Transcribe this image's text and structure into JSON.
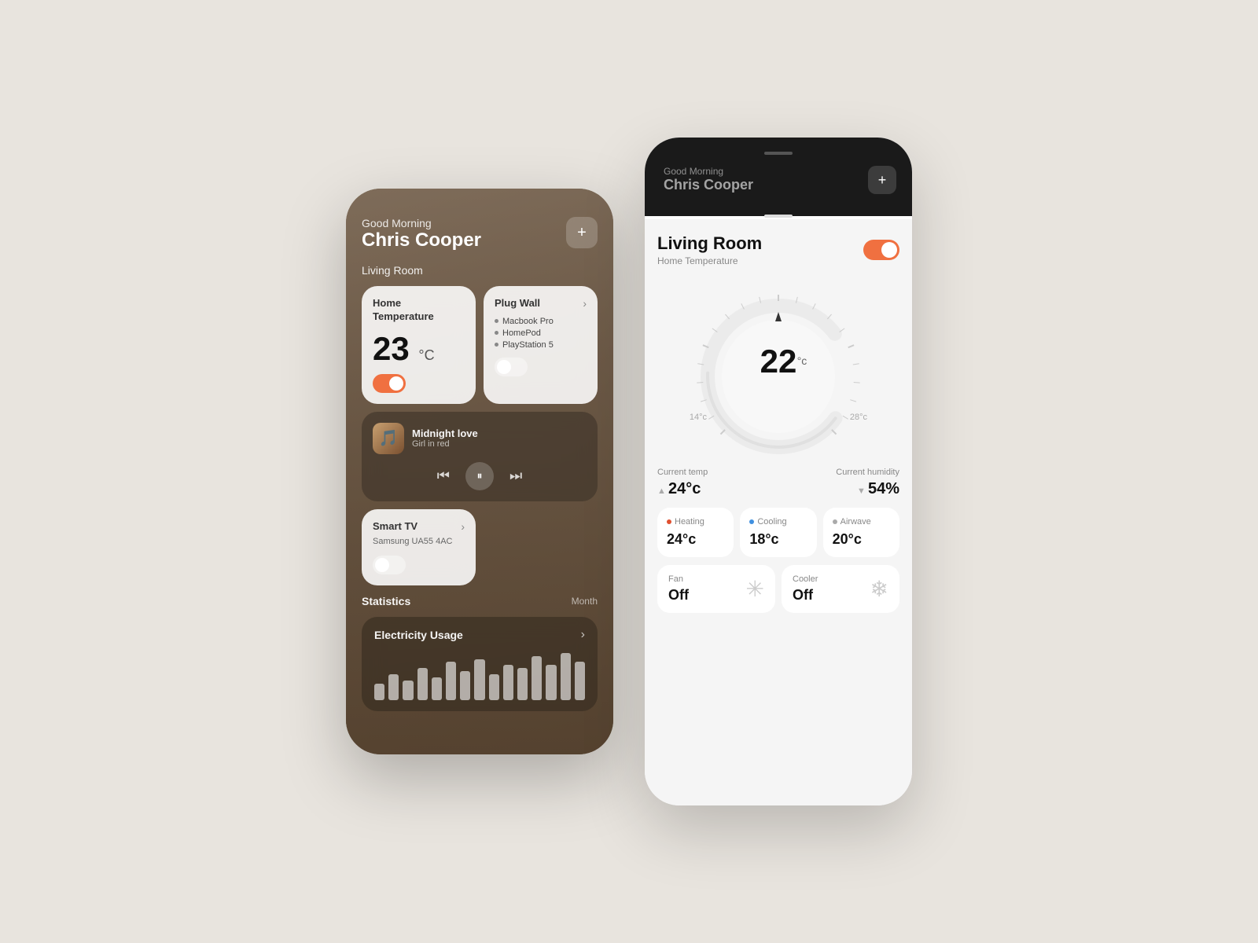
{
  "left_phone": {
    "greeting_small": "Good Morning",
    "greeting_name": "Chris Cooper",
    "add_btn": "+",
    "section": "Living Room",
    "temp_card": {
      "title_line1": "Home",
      "title_line2": "Temperature",
      "value": "23",
      "unit": "°C",
      "toggle_on": true
    },
    "plug_card": {
      "title": "Plug Wall",
      "arrow": "›",
      "items": [
        "Macbook Pro",
        "HomePod",
        "PlayStation 5"
      ],
      "toggle_on": false
    },
    "music_card": {
      "title": "Midnight love",
      "artist": "Girl in red",
      "emoji": "🎵"
    },
    "tv_card": {
      "title": "Smart TV",
      "subtitle": "Samsung UA55 4AC",
      "arrow": "›",
      "toggle_on": false
    },
    "stats_label": "Statistics",
    "stats_period": "Month",
    "electricity_card": {
      "title": "Electricity Usage",
      "arrow": "›",
      "bars": [
        20,
        35,
        25,
        45,
        30,
        55,
        40,
        60,
        35,
        50,
        45,
        65,
        50,
        70,
        55
      ]
    }
  },
  "right_phone": {
    "top_greeting_small": "Good Morning",
    "top_greeting_name": "Chris Cooper",
    "add_btn": "+",
    "room_title": "Living Room",
    "sub_label": "Home Temperature",
    "toggle_on": true,
    "dial": {
      "current_temp": "22",
      "unit": "°c",
      "min_label": "14°c",
      "max_label": "28°c"
    },
    "current_temp": {
      "label": "Current temp",
      "value": "24°c",
      "arrow": "▲"
    },
    "current_humidity": {
      "label": "Current humidity",
      "value": "54%",
      "arrow": "▼"
    },
    "modes": [
      {
        "label": "Heating",
        "dot": "red",
        "value": "24°c"
      },
      {
        "label": "Cooling",
        "dot": "blue",
        "value": "18°c"
      },
      {
        "label": "Airwave",
        "dot": "gray",
        "value": "20°c"
      }
    ],
    "bottom_items": [
      {
        "label": "Fan",
        "value": "Off",
        "icon": "❄"
      },
      {
        "label": "Cooler",
        "value": "Off",
        "icon": "❄"
      }
    ]
  }
}
